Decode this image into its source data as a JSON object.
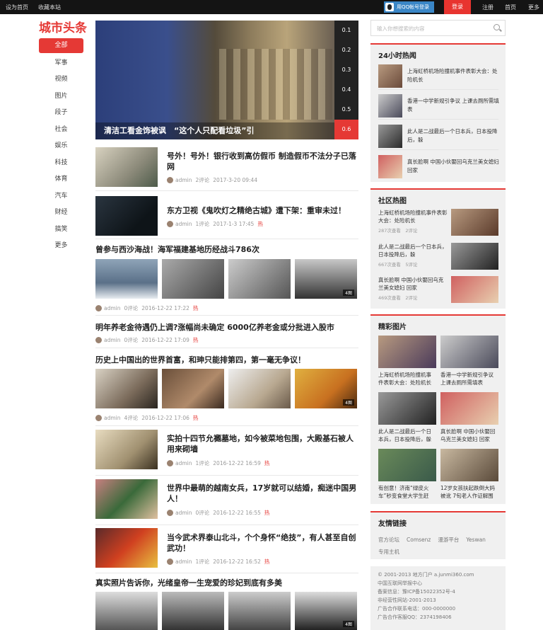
{
  "topbar": {
    "set_home": "设为首页",
    "bookmark": "收藏本站",
    "qq_login": "用QQ帐号登录",
    "login": "登录",
    "register": "注册",
    "home": "首页",
    "more": "更多"
  },
  "logo": "城市头条",
  "nav": [
    "全部",
    "军事",
    "视频",
    "图片",
    "段子",
    "社会",
    "娱乐",
    "科技",
    "体育",
    "汽车",
    "财经",
    "搞笑",
    "更多"
  ],
  "slider": {
    "caption": "清洁工看金饰被讽　“这个人只配看垃圾”引",
    "numbers": [
      "0.1",
      "0.2",
      "0.3",
      "0.4",
      "0.5",
      "0.6"
    ]
  },
  "articles": [
    {
      "title": "号外！号外！银行收到高仿假币 制造假币不法分子已落网",
      "author": "admin",
      "comments": "2评论",
      "date": "2017-3-20 09:44",
      "hot": ""
    },
    {
      "title": "东方卫视《鬼吹灯之精绝古城》遭下架：重审未过！",
      "author": "admin",
      "comments": "1评论",
      "date": "2017-1-3 17:45",
      "hot": "热"
    },
    {
      "title": "曾参与西沙海战！海军福建基地历经战斗786次",
      "author": "admin",
      "comments": "0评论",
      "date": "2016-12-22 17:22",
      "hot": "热",
      "badge": "4图"
    },
    {
      "title": "明年养老金待遇仍上调?涨幅尚未确定 6000亿养老金或分批进入股市",
      "author": "admin",
      "comments": "0评论",
      "date": "2016-12-22 17:09",
      "hot": "热"
    },
    {
      "title": "历史上中国出的世界首富，和珅只能排第四，第一毫无争议！",
      "author": "admin",
      "comments": "4评论",
      "date": "2016-12-22 17:06",
      "hot": "热",
      "badge": "4图"
    },
    {
      "title": "实拍十四节允禵墓地，如今被菜地包围，大殿基石被人用来砌墙",
      "author": "admin",
      "comments": "1评论",
      "date": "2016-12-22 16:59",
      "hot": "热"
    },
    {
      "title": "世界中最萌的越南女兵，17岁就可以结婚，痴迷中国男人！",
      "author": "admin",
      "comments": "0评论",
      "date": "2016-12-22 16:55",
      "hot": "热"
    },
    {
      "title": "当今武术界泰山北斗，个个身怀“绝技”，有人甚至自创武功！",
      "author": "admin",
      "comments": "1评论",
      "date": "2016-12-22 16:52",
      "hot": "热"
    },
    {
      "title": "真实照片告诉你，光绪皇帝一生宠爱的珍妃到底有多美",
      "badge": "4图"
    }
  ],
  "search": {
    "placeholder": "输入你想搜索的内容"
  },
  "hot24": {
    "title": "24小时热闻",
    "items": [
      "上海虹桥机场险撞机事件表彰大会：处险机长",
      "香港一中学新规引争议 上课去厕所需填表",
      "此人是二战最后一个日本兵，日本投降后，躲",
      "真长脸啊 中国小伙娶回乌克兰美女媳妇 回家"
    ]
  },
  "community": {
    "title": "社区热图",
    "items": [
      {
        "text": "上海虹桥机场险撞机事件表彰大会：处险机长",
        "views": "287次查看",
        "comments": "2评论"
      },
      {
        "text": "此人是二战最后一个日本兵，日本投降后，躲",
        "views": "667次查看",
        "comments": "5评论"
      },
      {
        "text": "真长脸啊 中国小伙娶回乌克兰美女媳妇 回家",
        "views": "469次查看",
        "comments": "2评论"
      }
    ]
  },
  "pictures": {
    "title": "精彩图片",
    "items": [
      "上海虹桥机场险撞机事件表彰大会：处险机长",
      "香港一中学新规引争议 上课去厕所需填表",
      "此人是二战最后一个日本兵，日本投降后，躲",
      "真长脸啊 中国小伙娶回乌克兰美女媳妇 回家",
      "有创意！济南“绿皮火车”秒变食堂大学生赶",
      "12岁女孩扶起跌倒大妈被讹 7旬老人作证解围"
    ]
  },
  "friend_links": {
    "title": "友情链接",
    "items": [
      "官方论坛",
      "Comsenz",
      "漫游平台",
      "Yeswan",
      "专用主机"
    ]
  },
  "footer": [
    "© 2001-2013 地方门户 a.junmi360.com",
    "中国互联网举报中心",
    "备案信息：豫ICP备15022352号-4",
    "非经营性网站-2001-2013",
    "广告合作联系电话：000-0000000",
    "广告合作客服QQ：2374198406"
  ]
}
